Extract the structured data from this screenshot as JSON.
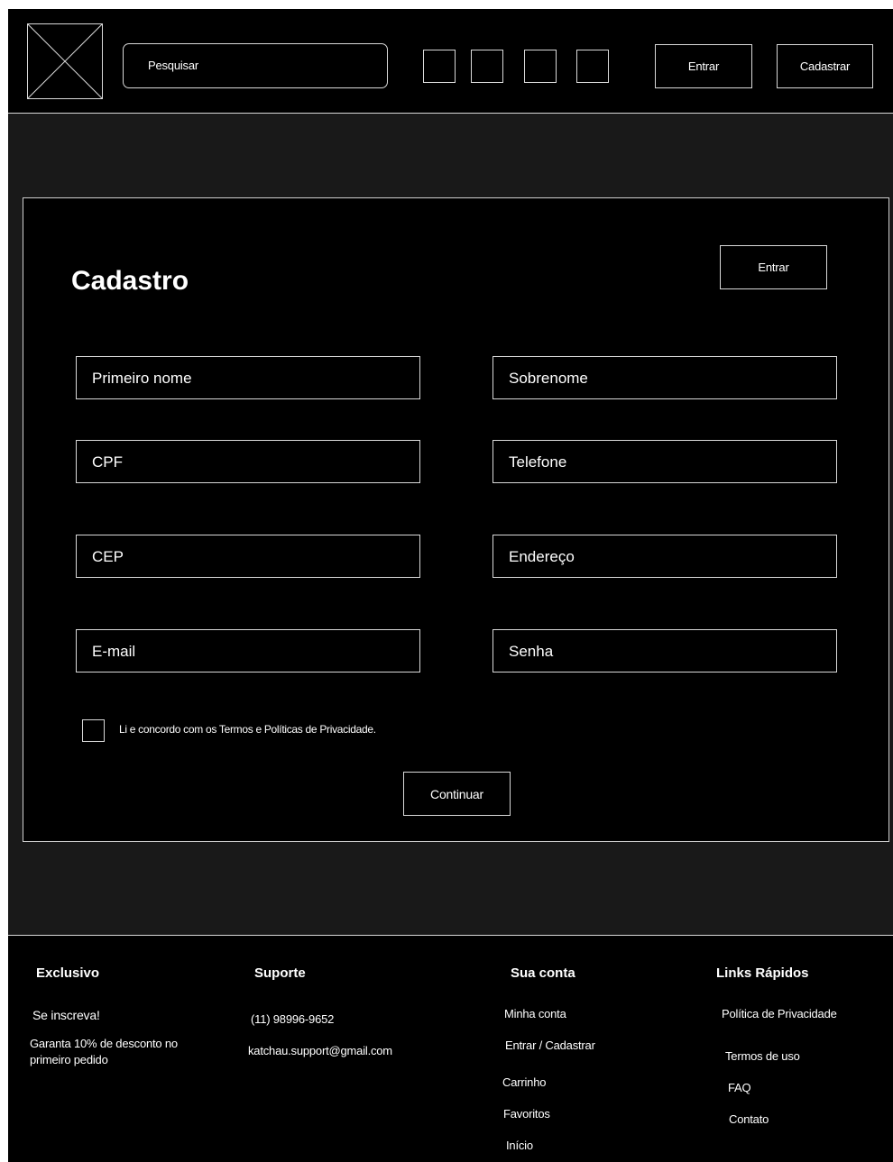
{
  "header": {
    "search_placeholder": "Pesquisar",
    "login_label": "Entrar",
    "register_label": "Cadastrar"
  },
  "form": {
    "title": "Cadastro",
    "login_label": "Entrar",
    "fields": {
      "first_name": "Primeiro nome",
      "last_name": "Sobrenome",
      "cpf": "CPF",
      "phone": "Telefone",
      "cep": "CEP",
      "address": "Endereço",
      "email": "E-mail",
      "password": "Senha"
    },
    "terms_label": "Li e concordo com os Termos e Políticas de Privacidade.",
    "continue_label": "Continuar"
  },
  "footer": {
    "exclusive": {
      "heading": "Exclusivo",
      "subscribe": "Se inscreva!",
      "discount": "Garanta 10% de desconto no primeiro pedido"
    },
    "support": {
      "heading": "Suporte",
      "phone": "(11) 98996-9652",
      "email": "katchau.support@gmail.com"
    },
    "account": {
      "heading": "Sua conta",
      "links": [
        "Minha conta",
        "Entrar / Cadastrar",
        "Carrinho",
        "Favoritos",
        "Início"
      ]
    },
    "quick_links": {
      "heading": "Links Rápidos",
      "links": [
        "Política de Privacidade",
        "Termos de uso",
        "FAQ",
        "Contato"
      ]
    }
  }
}
